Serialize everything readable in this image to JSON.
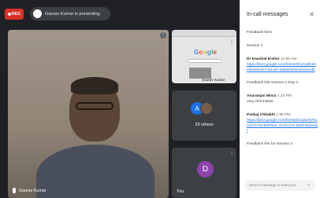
{
  "topbar": {
    "rec_label": "REC",
    "presenting_text": "Gaurav Kumar is presenting"
  },
  "main_tile": {
    "name": "Gaurav Kumar",
    "more": "⋮"
  },
  "side_tiles": {
    "screen": {
      "google_text": "Google",
      "name": "Saurav Kumar",
      "more": "⋮"
    },
    "others": {
      "avatar_letter": "A",
      "count_text": "29 others"
    },
    "self": {
      "avatar_letter": "D",
      "name": "You",
      "mute": "⁝"
    }
  },
  "panel": {
    "title": "In-call messages",
    "close": "✕",
    "intro": [
      "Feedback form",
      "session 1"
    ],
    "messages": [
      {
        "sender": "Dr Kaushal Kishor",
        "time": "11:56 AM",
        "link": "https://docs.google.com/forms/d/1yHuBhn0Mh2Mu0vkYnbLwkY4Mb0hIDkeM2Ge/edit",
        "text": "Feedback link session 1 Day 4"
      },
      {
        "sender": "Anuranjan Misra",
        "time": "1:23 PM",
        "text": "very informative"
      },
      {
        "sender": "Pankaj Chhabhi",
        "time": "1:35 PM",
        "link": "https://docs.google.com/forms/d/1w8LNVRxLkcFSYDcb8OfeVr_KLOV1cK-k5KFI0ee/edit",
        "text": "Feedback link for session 2"
      }
    ],
    "send_placeholder": "Send a message to everyone",
    "send_icon": "➤"
  }
}
